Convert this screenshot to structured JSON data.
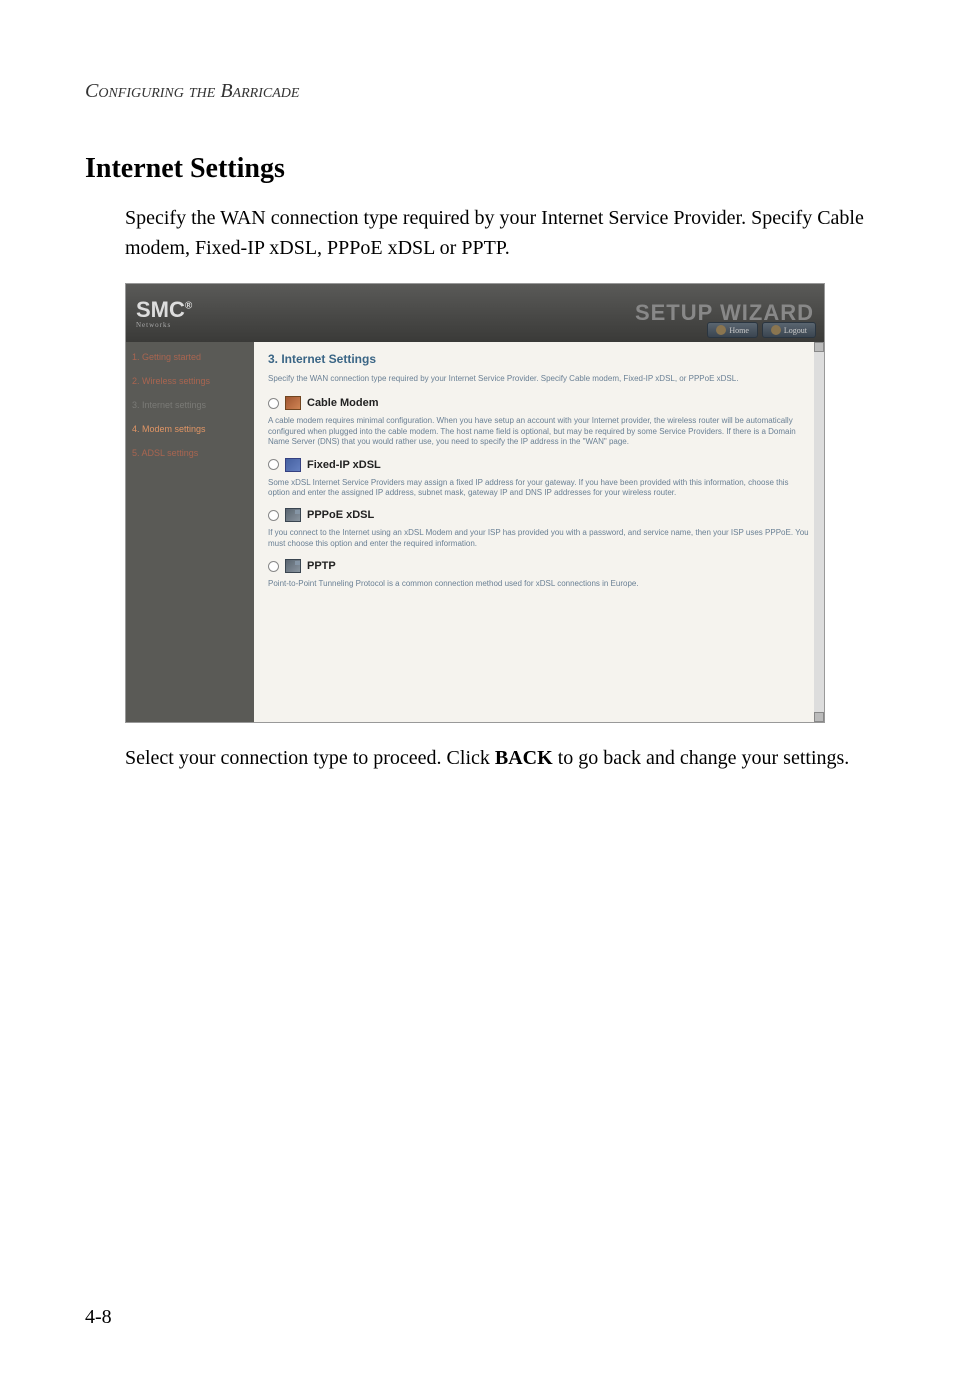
{
  "header": "Configuring the Barricade",
  "section_title": "Internet Settings",
  "intro_text": "Specify the WAN connection type required by your Internet Service Provider. Specify Cable modem, Fixed-IP xDSL, PPPoE xDSL or PPTP.",
  "wizard": {
    "logo": "SMC",
    "logo_sub": "Networks",
    "title": "SETUP WIZARD",
    "btn_home": "Home",
    "btn_logout": "Logout",
    "sidebar": {
      "item1": "1. Getting started",
      "item2": "2. Wireless settings",
      "item3": "3. Internet settings",
      "item4": "4. Modem settings",
      "item5": "5. ADSL settings"
    },
    "content": {
      "title": "3. Internet Settings",
      "desc": "Specify the WAN connection type required by your Internet Service Provider. Specify Cable modem, Fixed-IP xDSL, or PPPoE xDSL.",
      "opt1_label": "Cable Modem",
      "opt1_desc": "A cable modem requires minimal configuration. When you have setup an account with your Internet provider, the wireless router will be automatically configured when plugged into the cable modem. The host name field is optional, but may be required by some Service Providers. If there is a Domain Name Server (DNS) that you would rather use, you need to specify the IP address in the \"WAN\" page.",
      "opt2_label": "Fixed-IP xDSL",
      "opt2_desc": "Some xDSL Internet Service Providers may assign a fixed IP address for your gateway. If you have been provided with this information, choose this option and enter the assigned IP address, subnet mask, gateway IP and DNS IP addresses for your wireless router.",
      "opt3_label": "PPPoE xDSL",
      "opt3_desc": "If you connect to the Internet using an xDSL Modem and your ISP has provided you with a password, and service name, then your ISP uses PPPoE. You must choose this option and enter the required information.",
      "opt4_label": "PPTP",
      "opt4_desc": "Point-to-Point Tunneling Protocol is a common connection method used for xDSL connections in Europe."
    }
  },
  "bottom_text_1": "Select your connection type to proceed. Click ",
  "bottom_text_bold": "BACK",
  "bottom_text_2": " to go back and change your settings.",
  "page_number": "4-8"
}
